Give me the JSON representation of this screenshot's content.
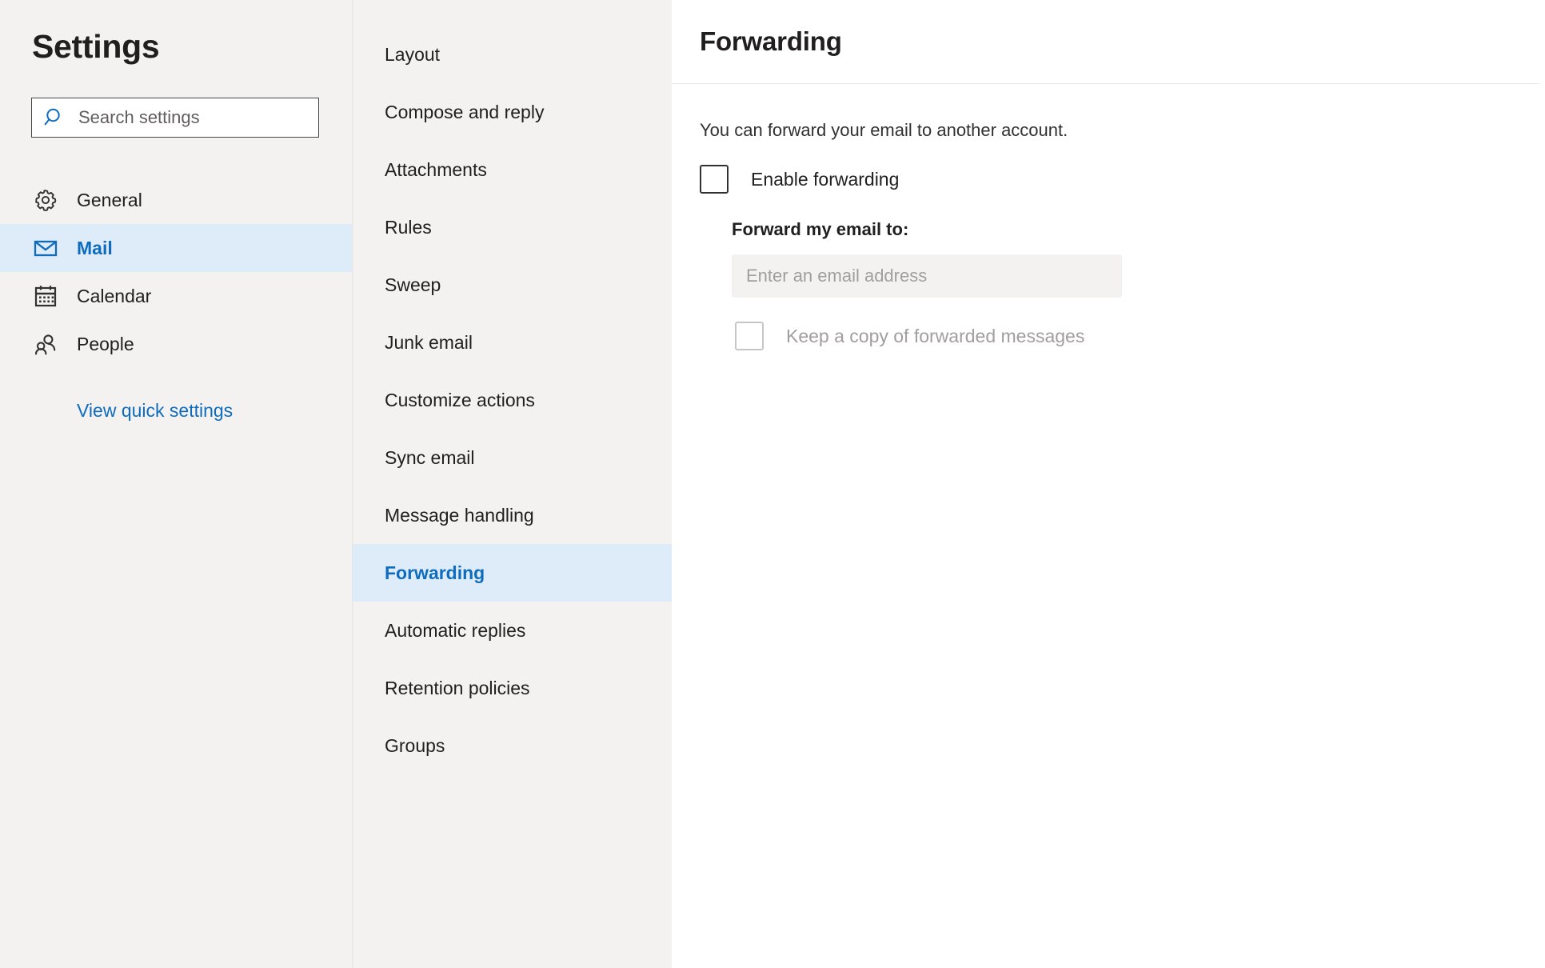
{
  "sidebar": {
    "title": "Settings",
    "search": {
      "placeholder": "Search settings",
      "value": "",
      "icon": "search-icon"
    },
    "items": [
      {
        "label": "General",
        "icon": "gear-icon",
        "selected": false
      },
      {
        "label": "Mail",
        "icon": "envelope-icon",
        "selected": true
      },
      {
        "label": "Calendar",
        "icon": "calendar-icon",
        "selected": false
      },
      {
        "label": "People",
        "icon": "people-icon",
        "selected": false
      }
    ],
    "quick_settings_link": "View quick settings"
  },
  "midnav": {
    "items": [
      {
        "label": "Layout",
        "selected": false
      },
      {
        "label": "Compose and reply",
        "selected": false
      },
      {
        "label": "Attachments",
        "selected": false
      },
      {
        "label": "Rules",
        "selected": false
      },
      {
        "label": "Sweep",
        "selected": false
      },
      {
        "label": "Junk email",
        "selected": false
      },
      {
        "label": "Customize actions",
        "selected": false
      },
      {
        "label": "Sync email",
        "selected": false
      },
      {
        "label": "Message handling",
        "selected": false
      },
      {
        "label": "Forwarding",
        "selected": true
      },
      {
        "label": "Automatic replies",
        "selected": false
      },
      {
        "label": "Retention policies",
        "selected": false
      },
      {
        "label": "Groups",
        "selected": false
      }
    ]
  },
  "content": {
    "title": "Forwarding",
    "description": "You can forward your email to another account.",
    "enable_forwarding": {
      "label": "Enable forwarding",
      "checked": false
    },
    "forward_to": {
      "label": "Forward my email to:",
      "placeholder": "Enter an email address",
      "value": ""
    },
    "keep_copy": {
      "label": "Keep a copy of forwarded messages",
      "checked": false,
      "disabled": true
    }
  },
  "colors": {
    "accent": "#0f6cbd",
    "selected_bg": "#deecf9",
    "panel_bg": "#f3f2f1",
    "content_bg": "#ffffff",
    "text": "#201f1e",
    "muted_text": "#a19f9d"
  }
}
